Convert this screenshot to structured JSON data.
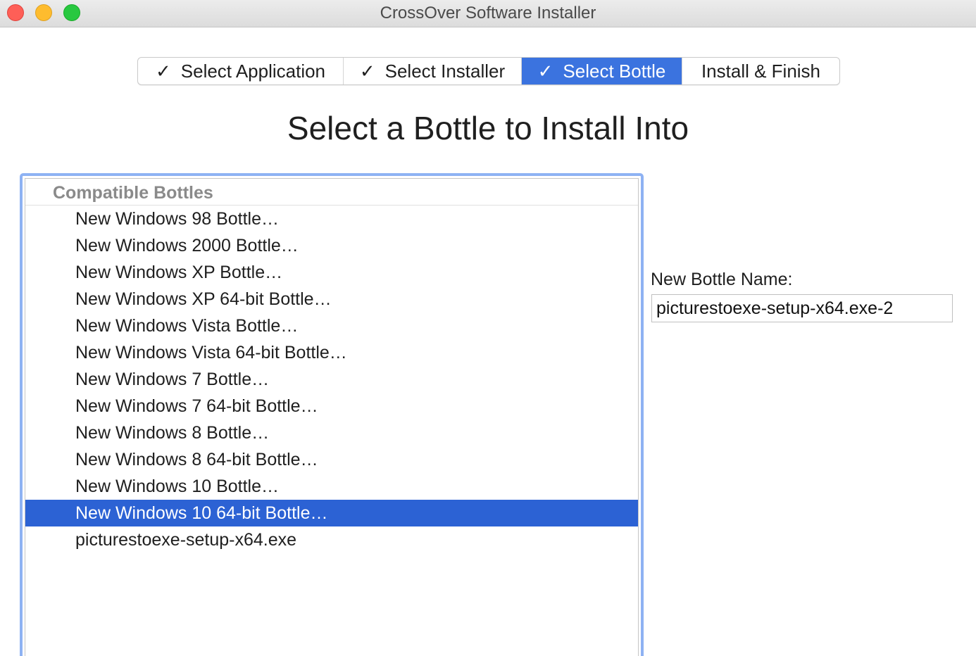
{
  "window": {
    "title": "CrossOver Software Installer"
  },
  "steps": [
    {
      "label": "Select Application",
      "checked": true,
      "active": false
    },
    {
      "label": "Select Installer",
      "checked": true,
      "active": false
    },
    {
      "label": "Select Bottle",
      "checked": true,
      "active": true
    },
    {
      "label": "Install & Finish",
      "checked": false,
      "active": false
    }
  ],
  "check_glyph": "✓",
  "heading": "Select a Bottle to Install Into",
  "bottles": {
    "header": "Compatible Bottles",
    "items": [
      "New Windows 98 Bottle…",
      "New Windows 2000 Bottle…",
      "New Windows XP Bottle…",
      "New Windows XP 64-bit Bottle…",
      "New Windows Vista Bottle…",
      "New Windows Vista 64-bit Bottle…",
      "New Windows 7 Bottle…",
      "New Windows 7 64-bit Bottle…",
      "New Windows 8 Bottle…",
      "New Windows 8 64-bit Bottle…",
      "New Windows 10 Bottle…",
      "New Windows 10 64-bit Bottle…",
      "picturestoexe-setup-x64.exe"
    ],
    "selected_index": 11
  },
  "new_bottle": {
    "label": "New Bottle Name:",
    "value": "picturestoexe-setup-x64.exe-2"
  },
  "colors": {
    "accent": "#3b73df",
    "selection": "#2c62d4",
    "focus_ring": "#8eb2f3"
  }
}
